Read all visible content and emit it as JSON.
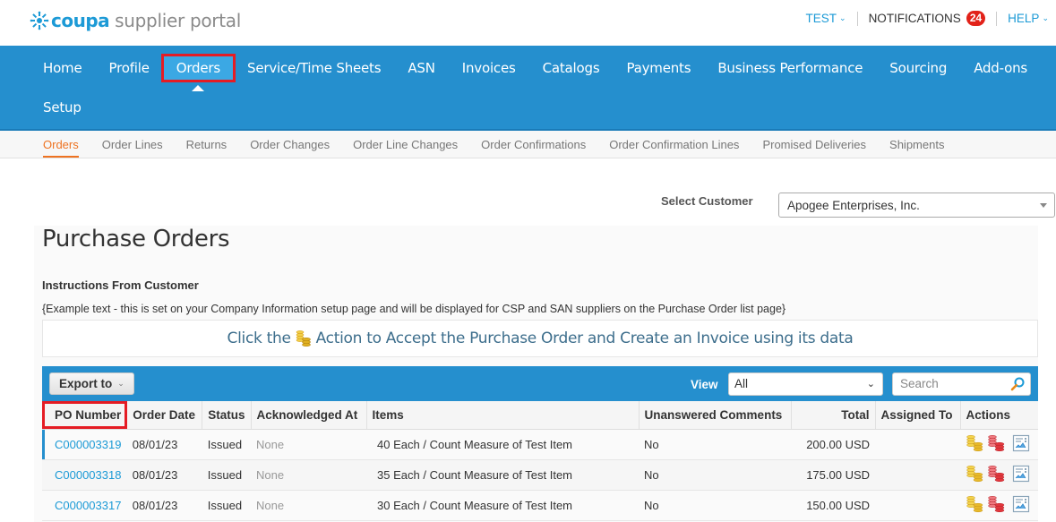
{
  "header": {
    "logo_brand": "coupa",
    "logo_text": "supplier portal",
    "user_menu": "TEST",
    "notifications_label": "NOTIFICATIONS",
    "notifications_count": "24",
    "help_menu": "HELP"
  },
  "main_nav": {
    "row1": [
      {
        "label": "Home"
      },
      {
        "label": "Profile"
      },
      {
        "label": "Orders",
        "active": true
      },
      {
        "label": "Service/Time Sheets"
      },
      {
        "label": "ASN"
      },
      {
        "label": "Invoices"
      },
      {
        "label": "Catalogs"
      },
      {
        "label": "Payments"
      },
      {
        "label": "Business Performance"
      },
      {
        "label": "Sourcing"
      },
      {
        "label": "Add-ons"
      }
    ],
    "row2": [
      {
        "label": "Setup"
      }
    ]
  },
  "sub_nav": [
    {
      "label": "Orders",
      "active": true
    },
    {
      "label": "Order Lines"
    },
    {
      "label": "Returns"
    },
    {
      "label": "Order Changes"
    },
    {
      "label": "Order Line Changes"
    },
    {
      "label": "Order Confirmations"
    },
    {
      "label": "Order Confirmation Lines"
    },
    {
      "label": "Promised Deliveries"
    },
    {
      "label": "Shipments"
    }
  ],
  "customer": {
    "label": "Select Customer",
    "selected": "Apogee Enterprises, Inc."
  },
  "page": {
    "title": "Purchase Orders",
    "instructions_title": "Instructions From Customer",
    "instructions_text": "{Example text - this is set on your Company Information setup page and will be displayed for CSP and SAN suppliers on the Purchase Order list page}",
    "banner_before": "Click the",
    "banner_after": "Action to Accept the Purchase Order and Create an Invoice using its data"
  },
  "toolbar": {
    "export_label": "Export to",
    "view_label": "View",
    "view_selected": "All",
    "search_placeholder": "Search"
  },
  "table": {
    "columns": [
      "PO Number",
      "Order Date",
      "Status",
      "Acknowledged At",
      "Items",
      "Unanswered Comments",
      "Total",
      "Assigned To",
      "Actions"
    ],
    "rows": [
      {
        "po_number": "C000003319",
        "order_date": "08/01/23",
        "status": "Issued",
        "acknowledged_at": "None",
        "items": "40 Each / Count Measure of Test Item",
        "unanswered_comments": "No",
        "total": "200.00 USD",
        "assigned_to": ""
      },
      {
        "po_number": "C000003318",
        "order_date": "08/01/23",
        "status": "Issued",
        "acknowledged_at": "None",
        "items": "35 Each / Count Measure of Test Item",
        "unanswered_comments": "No",
        "total": "175.00 USD",
        "assigned_to": ""
      },
      {
        "po_number": "C000003317",
        "order_date": "08/01/23",
        "status": "Issued",
        "acknowledged_at": "None",
        "items": "30 Each / Count Measure of Test Item",
        "unanswered_comments": "No",
        "total": "150.00 USD",
        "assigned_to": ""
      }
    ],
    "row_actions": [
      "create-invoice-icon",
      "flip-to-credit-note-icon",
      "print-view-icon"
    ]
  },
  "colors": {
    "brand_blue": "#258fce",
    "link_blue": "#1c9ad6",
    "active_orange": "#ee7322",
    "highlight_red": "#e51c24",
    "badge_red": "#e22219",
    "coin_gold": "#e8b92a",
    "coin_red": "#e2373d"
  }
}
